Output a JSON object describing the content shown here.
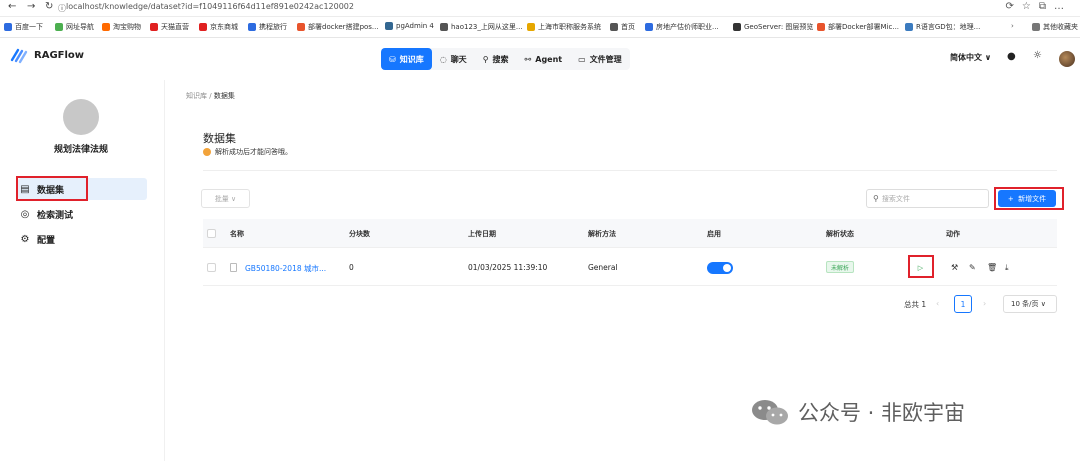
{
  "browser": {
    "url": "localhost/knowledge/dataset?id=f1049116f64d11ef891e0242ac120002",
    "bookmarks": [
      {
        "label": "百度一下",
        "color": "#2d6be0"
      },
      {
        "label": "网址导航",
        "color": "#4caf50"
      },
      {
        "label": "淘宝购物",
        "color": "#ff6a00"
      },
      {
        "label": "天猫直营",
        "color": "#e02020"
      },
      {
        "label": "京东商城",
        "color": "#e02020"
      },
      {
        "label": "携程旅行",
        "color": "#2d6be0"
      },
      {
        "label": "部署docker搭建pos...",
        "color": "#e8542c"
      },
      {
        "label": "pgAdmin 4",
        "color": "#336791"
      },
      {
        "label": "hao123_上网从这里...",
        "color": "#555555"
      },
      {
        "label": "上海市职称服务系统",
        "color": "#e6a700"
      },
      {
        "label": "首页",
        "color": "#555555"
      },
      {
        "label": "房地产估价师职业...",
        "color": "#2d6be0"
      },
      {
        "label": "GeoServer: 图层预览",
        "color": "#333333"
      },
      {
        "label": "部署Docker部署Mic...",
        "color": "#e8542c"
      },
      {
        "label": "R语言GD包：地理...",
        "color": "#3b7bbf"
      },
      {
        "label": "其他收藏夹",
        "color": "#777777"
      }
    ]
  },
  "app": {
    "name": "RAGFlow",
    "nav": [
      {
        "label": "知识库",
        "icon": "database-icon",
        "active": true
      },
      {
        "label": "聊天",
        "icon": "chat-icon",
        "active": false
      },
      {
        "label": "搜索",
        "icon": "search-icon",
        "active": false
      },
      {
        "label": "Agent",
        "icon": "agent-icon",
        "active": false
      },
      {
        "label": "文件管理",
        "icon": "folder-icon",
        "active": false
      }
    ],
    "language": "简体中文"
  },
  "sidebar": {
    "kb_name": "规划法律法规",
    "items": [
      {
        "label": "数据集",
        "icon": "document-icon"
      },
      {
        "label": "检索测试",
        "icon": "target-icon"
      },
      {
        "label": "配置",
        "icon": "gear-icon"
      }
    ]
  },
  "main": {
    "breadcrumb": {
      "parent": "知识库",
      "sep": "/",
      "current": "数据集"
    },
    "title": "数据集",
    "subtitle": "解析成功后才能问答哦。",
    "bulk_label": "批量",
    "search_placeholder": "搜索文件",
    "add_label": "新增文件",
    "columns": [
      "名称",
      "分块数",
      "上传日期",
      "解析方法",
      "启用",
      "解析状态",
      "动作"
    ],
    "rows": [
      {
        "name": "GB50180-2018 城市...",
        "chunks": "0",
        "date": "01/03/2025 11:39:10",
        "method": "General",
        "enabled": true,
        "status": "未解析"
      }
    ],
    "pagination": {
      "total": "总共 1",
      "page": "1",
      "page_size": "10 条/页"
    }
  },
  "watermark": {
    "text": "公众号 · 非欧宇宙"
  },
  "colors": {
    "accent": "#1677ff",
    "highlight": "#e0212b",
    "success": "#3aa657"
  }
}
